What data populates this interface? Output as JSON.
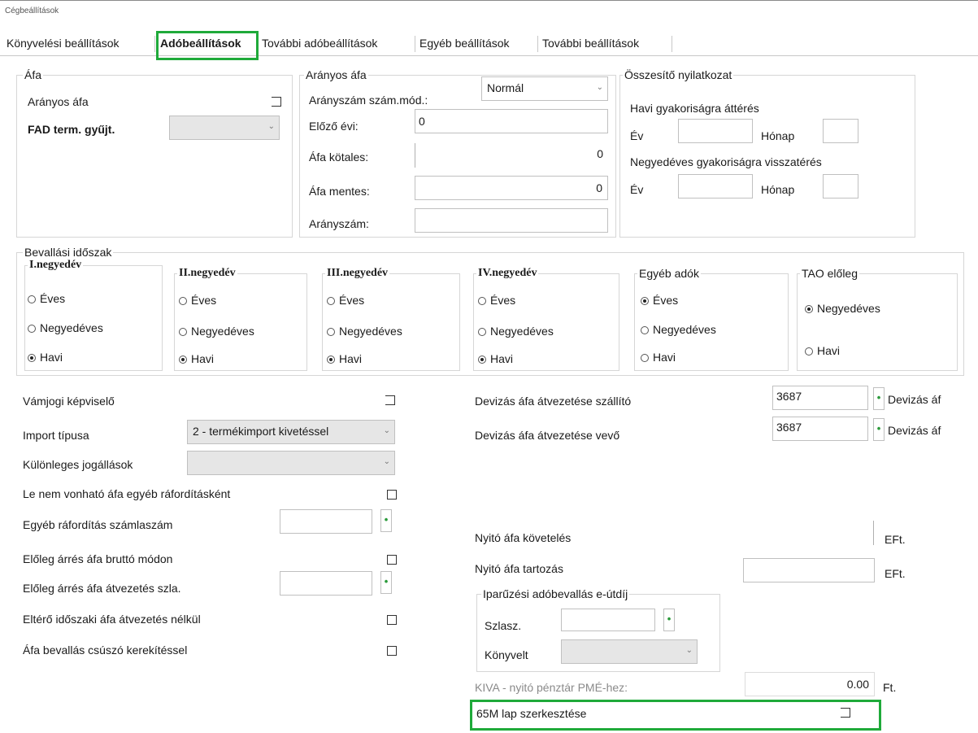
{
  "window": {
    "title": "Cégbeállítások"
  },
  "tabs": [
    "Könyvelési beállítások",
    "Adóbeállítások",
    "További adóbeállítások",
    "Egyéb beállítások",
    "További beállítások"
  ],
  "afa": {
    "title": "Áfa",
    "aranyos_afa": "Arányos áfa",
    "fad_label": "FAD term. gyűjt."
  },
  "aranyos": {
    "title": "Arányos áfa",
    "mod_label": "Arányszám szám.mód.:",
    "mod_value": "Normál",
    "elozo_label": "Előző évi:",
    "elozo_value": "0",
    "koteles_label": "Áfa kötales:",
    "koteles_value": "0",
    "mentes_label": "Áfa mentes:",
    "mentes_value": "0",
    "aranyszam_label": "Arányszám:"
  },
  "osszesito": {
    "title": "Összesítő nyilatkozat",
    "havi_label": "Havi gyakoriságra áttérés",
    "ev1": "Év",
    "honap1": "Hónap",
    "negyed_label": "Negyedéves gyakoriságra visszatérés",
    "ev2": "Év",
    "honap2": "Hónap"
  },
  "bevallasi": {
    "title": "Bevallási időszak",
    "groups": [
      {
        "title": "I.negyedév",
        "options": [
          "Éves",
          "Negyedéves",
          "Havi"
        ],
        "selected": 2
      },
      {
        "title": "II.negyedév",
        "options": [
          "Éves",
          "Negyedéves",
          "Havi"
        ],
        "selected": 2
      },
      {
        "title": "III.negyedév",
        "options": [
          "Éves",
          "Negyedéves",
          "Havi"
        ],
        "selected": 2
      },
      {
        "title": "IV.negyedév",
        "options": [
          "Éves",
          "Negyedéves",
          "Havi"
        ],
        "selected": 2
      },
      {
        "title": "Egyéb adók",
        "options": [
          "Éves",
          "Negyedéves",
          "Havi"
        ],
        "selected": 0
      }
    ],
    "tao": {
      "title": "TAO előleg",
      "options": [
        "Negyedéves",
        "Havi"
      ],
      "selected": 0
    }
  },
  "left": {
    "vamjogi": "Vámjogi képviselő",
    "import_label": "Import típusa",
    "import_value": "2 - termékimport kivetéssel",
    "kulonleges": "Különleges jogállások",
    "le_nem": "Le nem vonható áfa egyéb ráfordításként",
    "egyeb_raf": "Egyéb ráfordítás számlaszám",
    "eloleg_brutto": "Előleg árrés áfa bruttó módon",
    "eloleg_atvez": "Előleg árrés áfa átvezetés szla.",
    "elt_idoszak": "Eltérő időszaki áfa átvezetés nélkül",
    "afa_csuszo": "Áfa bevallás csúszó kerekítéssel"
  },
  "right": {
    "deviza_szallito": "Devizás áfa átvezetése szállító",
    "deviza_szallito_value": "3687",
    "deviza_vevo": "Devizás áfa átvezetése vevő",
    "deviza_vevo_value": "3687",
    "deviza_side": "Devizás áf",
    "nyito_kov": "Nyitó áfa követelés",
    "nyito_tart": "Nyitó áfa tartozás",
    "eft1": "EFt.",
    "eft2": "EFt.",
    "iparuz_title": "Iparűzési adóbevallás e-útdíj",
    "szlasz": "Szlasz.",
    "konyvelt": "Könyvelt",
    "kiva_label": "KIVA - nyitó pénztár PMÉ-hez:",
    "kiva_value": "0.00",
    "kiva_unit": "Ft.",
    "lap65m": "65M lap szerkesztése"
  }
}
